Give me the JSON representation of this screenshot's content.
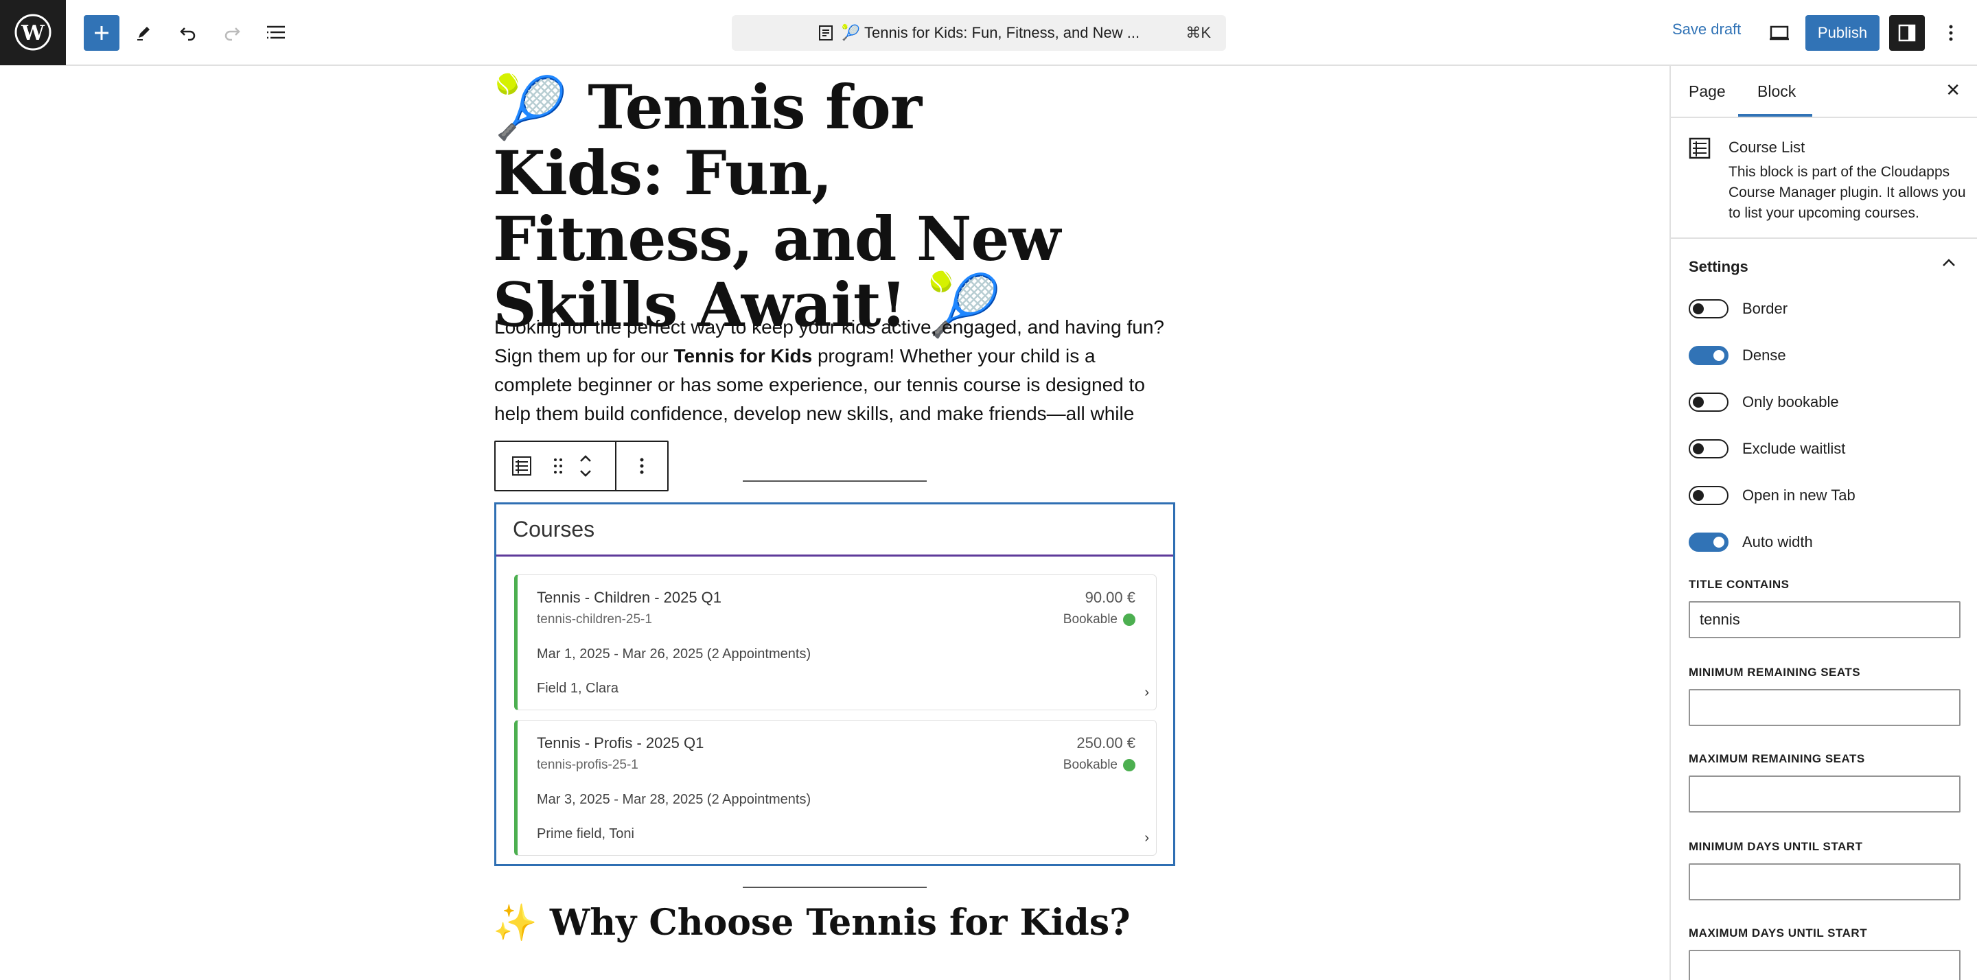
{
  "topbar": {
    "doc_title": "🎾 Tennis for Kids: Fun, Fitness, and New ...",
    "shortcut": "⌘K",
    "save_draft": "Save draft",
    "publish": "Publish"
  },
  "post": {
    "title": "🎾 Tennis for Kids: Fun, Fitness, and New Skills Await! 🎾",
    "intro_before": "Looking for the perfect way to keep your kids active, engaged, and having fun? Sign them up for our ",
    "intro_bold": "Tennis for Kids",
    "intro_after": " program! Whether your child is a complete beginner or has some experience, our tennis course is designed to help them build confidence, develop new skills, and make friends—all while enjoying the game.",
    "heading2": "✨ Why Choose Tennis for Kids?"
  },
  "course_block": {
    "heading": "Courses",
    "courses": [
      {
        "title": "Tennis - Children - 2025 Q1",
        "code": "tennis-children-25-1",
        "price": "90.00 €",
        "status": "Bookable",
        "dates": "Mar 1, 2025 - Mar 26, 2025 (2 Appointments)",
        "location": "Field 1, Clara"
      },
      {
        "title": "Tennis - Profis - 2025 Q1",
        "code": "tennis-profis-25-1",
        "price": "250.00 €",
        "status": "Bookable",
        "dates": "Mar 3, 2025 - Mar 28, 2025 (2 Appointments)",
        "location": "Prime field, Toni"
      }
    ]
  },
  "sidebar": {
    "tabs": [
      "Page",
      "Block"
    ],
    "active_tab": "Block",
    "block_name": "Course List",
    "block_desc": "This block is part of the Cloudapps Course Manager plugin. It allows you to list your upcoming courses.",
    "settings_title": "Settings",
    "toggles": [
      {
        "label": "Border",
        "on": false
      },
      {
        "label": "Dense",
        "on": true
      },
      {
        "label": "Only bookable",
        "on": false
      },
      {
        "label": "Exclude waitlist",
        "on": false
      },
      {
        "label": "Open in new Tab",
        "on": false
      },
      {
        "label": "Auto width",
        "on": true
      }
    ],
    "fields": [
      {
        "label": "TITLE CONTAINS",
        "value": "tennis"
      },
      {
        "label": "MINIMUM REMAINING SEATS",
        "value": ""
      },
      {
        "label": "MAXIMUM REMAINING SEATS",
        "value": ""
      },
      {
        "label": "MINIMUM DAYS UNTIL START",
        "value": ""
      },
      {
        "label": "MAXIMUM DAYS UNTIL START",
        "value": ""
      }
    ]
  },
  "colors": {
    "accent": "#3173b6",
    "bookable": "#4caf50",
    "header_underline": "#5e3a9a"
  }
}
